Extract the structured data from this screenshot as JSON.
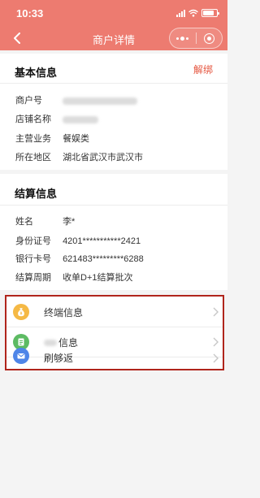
{
  "status_bar": {
    "time": "10:33"
  },
  "nav": {
    "title": "商户详情"
  },
  "basic_info": {
    "title": "基本信息",
    "unbind_label": "解绑",
    "rows": [
      {
        "label": "商户号",
        "value": "",
        "redacted": true
      },
      {
        "label": "店铺名称",
        "value": "",
        "redacted": true
      },
      {
        "label": "主营业务",
        "value": "餐娱类"
      },
      {
        "label": "所在地区",
        "value": "湖北省武汉市武汉市"
      }
    ]
  },
  "settlement_info": {
    "title": "结算信息",
    "rows": [
      {
        "label": "姓名",
        "value": "李*"
      },
      {
        "label": "身份证号",
        "value": "4201***********2421"
      },
      {
        "label": "银行卡号",
        "value": "621483*********6288"
      },
      {
        "label": "结算周期",
        "value": "收单D+1结算批次"
      }
    ]
  },
  "menu": {
    "items": [
      {
        "label": "终端信息",
        "icon": "money-bag-icon"
      },
      {
        "label": "信息",
        "icon": "document-icon",
        "label_prefix_redacted": true
      },
      {
        "label": "刷够返",
        "icon": "envelope-icon"
      }
    ]
  },
  "colors": {
    "header_bg": "#ed7b70",
    "unbind_text": "#e5553f",
    "highlight_border": "#b0251c",
    "icon_bag": "#f5b945",
    "icon_doc": "#5dbb63",
    "icon_mail": "#4e85e8"
  }
}
